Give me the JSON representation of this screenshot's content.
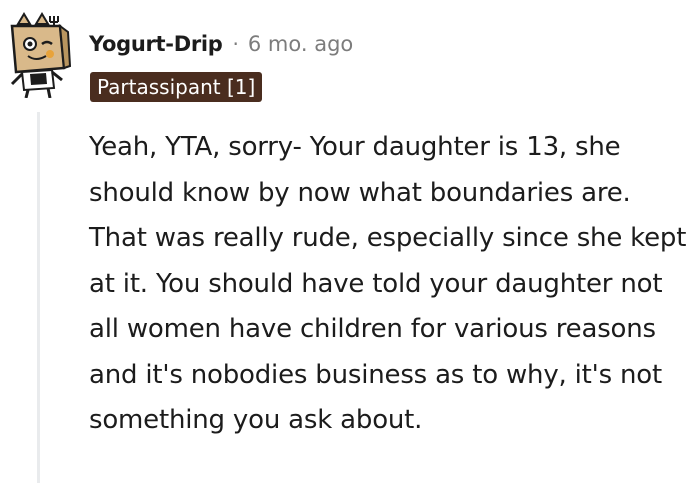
{
  "comment": {
    "author": "Yogurt-Drip",
    "separator": "·",
    "timestamp": "6 mo. ago",
    "flair": "Partassipant [1]",
    "body": "Yeah, YTA, sorry- Your daughter is 13, she should know by now what boundaries are. That was really rude, especially since she kept at it. You should have told your daughter not all women have children for various reasons and it's nobodies business as to why, it's not something you ask about."
  },
  "avatar": {
    "icon": "snoo-box-avatar-icon",
    "colors": {
      "box": "#d9b98a",
      "box_dark": "#b8955f",
      "outline": "#1c1c1c",
      "accent": "#e8a33a"
    }
  },
  "theme": {
    "text": "#1c1c1c",
    "muted": "#7c7c7c",
    "flair_bg": "#4a2d1f",
    "flair_text": "#ffffff",
    "thread_line": "#e9ebed"
  }
}
